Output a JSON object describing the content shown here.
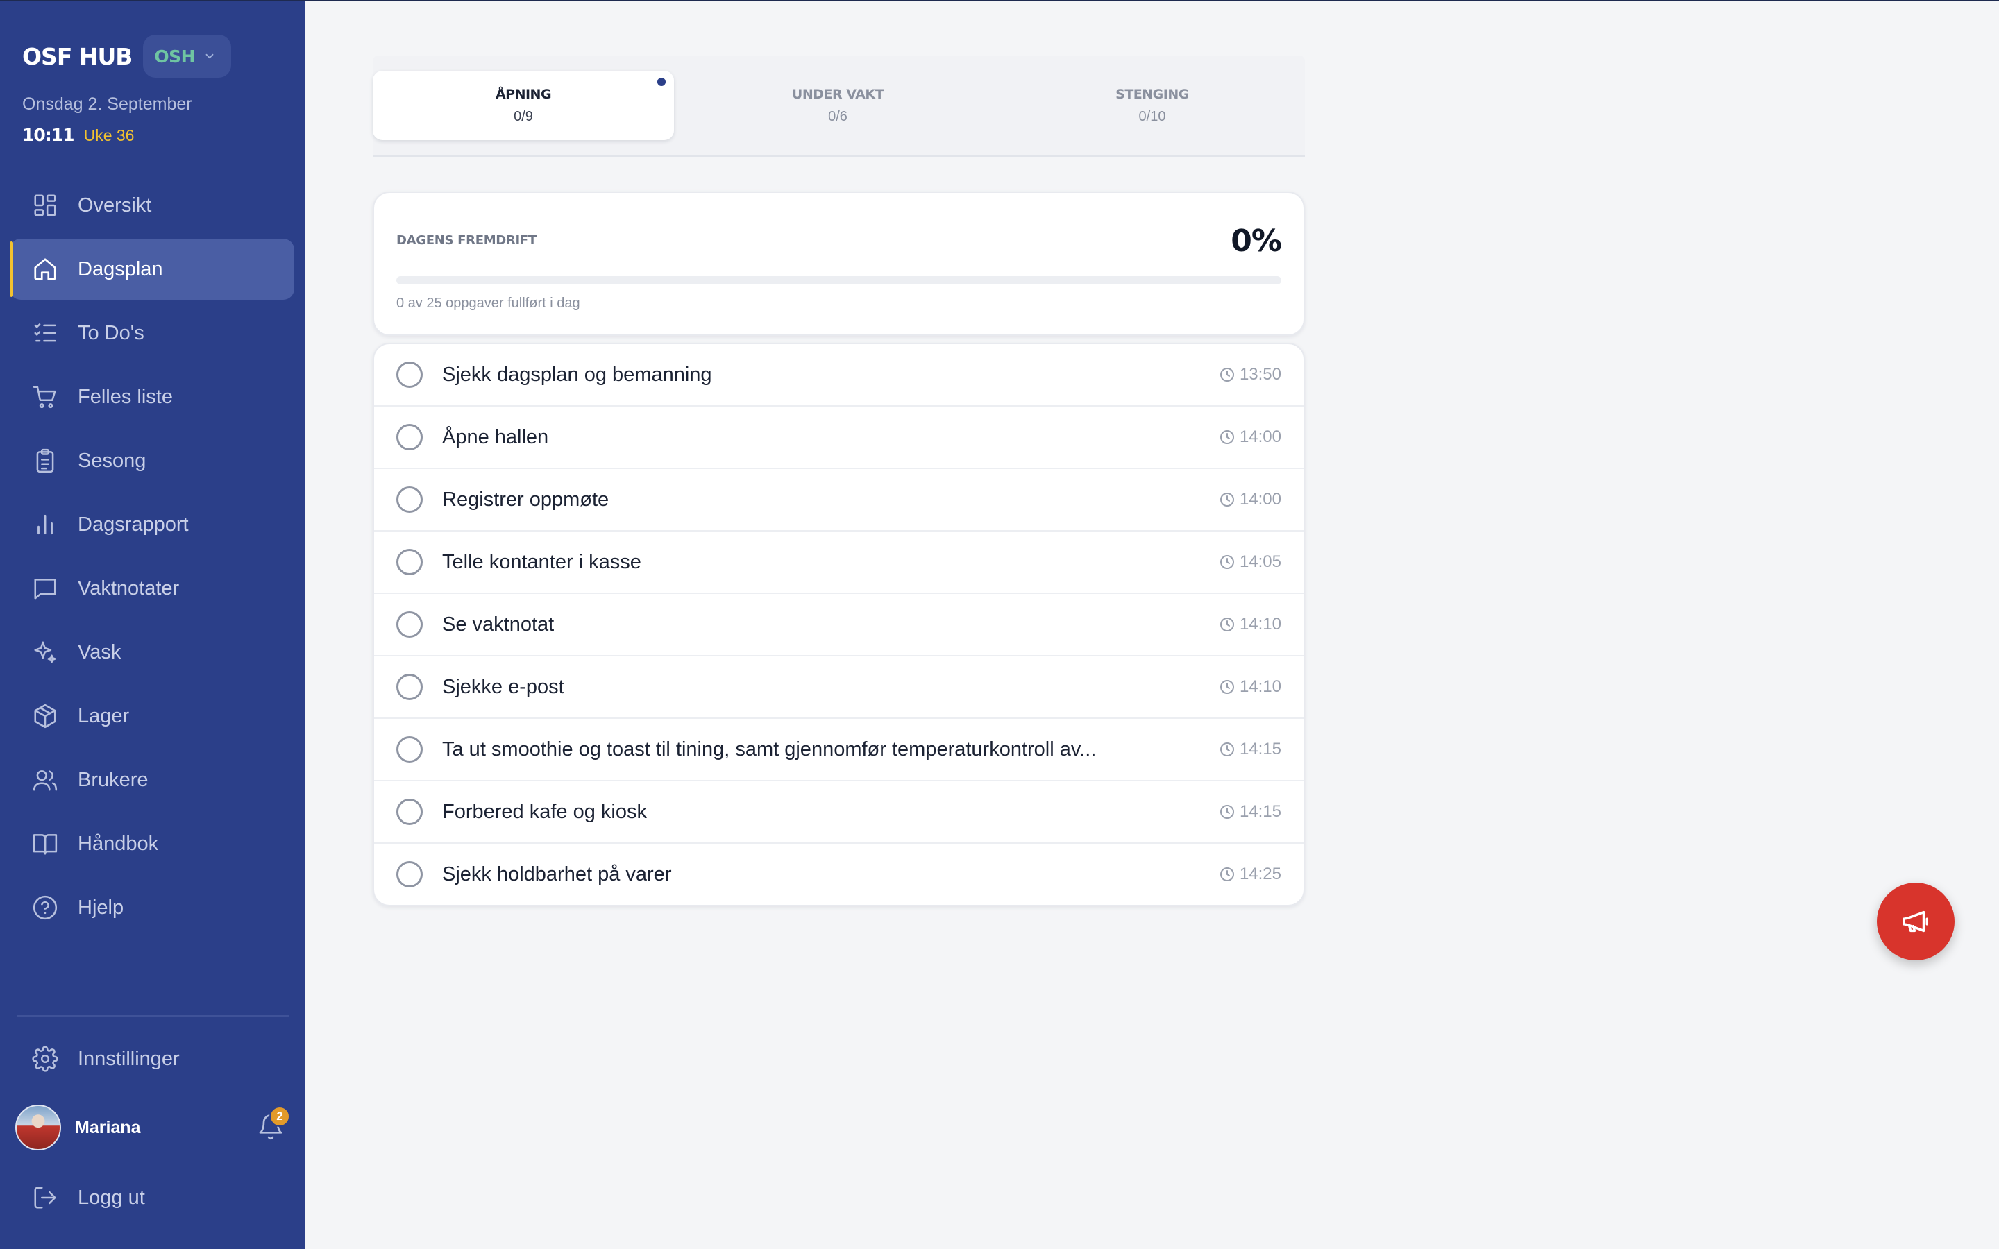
{
  "sidebar": {
    "brand": "OSF HUB",
    "org_code": "OSH",
    "date": "Onsdag 2. September",
    "time": "10:11",
    "week": "Uke 36",
    "nav": [
      {
        "label": "Oversikt",
        "icon": "grid-icon"
      },
      {
        "label": "Dagsplan",
        "icon": "home-icon",
        "active": true
      },
      {
        "label": "To Do's",
        "icon": "checklist-icon"
      },
      {
        "label": "Felles liste",
        "icon": "cart-icon"
      },
      {
        "label": "Sesong",
        "icon": "clipboard-icon"
      },
      {
        "label": "Dagsrapport",
        "icon": "bar-chart-icon"
      },
      {
        "label": "Vaktnotater",
        "icon": "message-icon"
      },
      {
        "label": "Vask",
        "icon": "sparkles-icon"
      },
      {
        "label": "Lager",
        "icon": "box-icon"
      },
      {
        "label": "Brukere",
        "icon": "users-icon"
      },
      {
        "label": "Håndbok",
        "icon": "book-icon"
      },
      {
        "label": "Hjelp",
        "icon": "help-circle-icon"
      }
    ],
    "settings_label": "Innstillinger",
    "user_name": "Mariana",
    "notification_count": "2",
    "logout_label": "Logg ut"
  },
  "tabs": [
    {
      "label": "ÅPNING",
      "count": "0/9",
      "active": true
    },
    {
      "label": "UNDER VAKT",
      "count": "0/6",
      "active": false
    },
    {
      "label": "STENGING",
      "count": "0/10",
      "active": false
    }
  ],
  "progress": {
    "title": "DAGENS FREMDRIFT",
    "percent_label": "0%",
    "percent": 0,
    "subtitle": "0 av 25 oppgaver fullført i dag"
  },
  "tasks": [
    {
      "title": "Sjekk dagsplan og bemanning",
      "time": "13:50"
    },
    {
      "title": "Åpne hallen",
      "time": "14:00"
    },
    {
      "title": "Registrer oppmøte",
      "time": "14:00"
    },
    {
      "title": "Telle kontanter i kasse",
      "time": "14:05"
    },
    {
      "title": "Se vaktnotat",
      "time": "14:10"
    },
    {
      "title": "Sjekke e-post",
      "time": "14:10"
    },
    {
      "title": "Ta ut smoothie og toast til tining, samt gjennomfør temperaturkontroll av...",
      "time": "14:15"
    },
    {
      "title": "Forbered kafe og kiosk",
      "time": "14:15"
    },
    {
      "title": "Sjekk holdbarhet på varer",
      "time": "14:25"
    }
  ],
  "colors": {
    "sidebar": "#2b3f89",
    "accent_yellow": "#f2c230",
    "org_green": "#6fc5a2",
    "fab_red": "#d8342c"
  },
  "fab_icon": "megaphone-icon"
}
